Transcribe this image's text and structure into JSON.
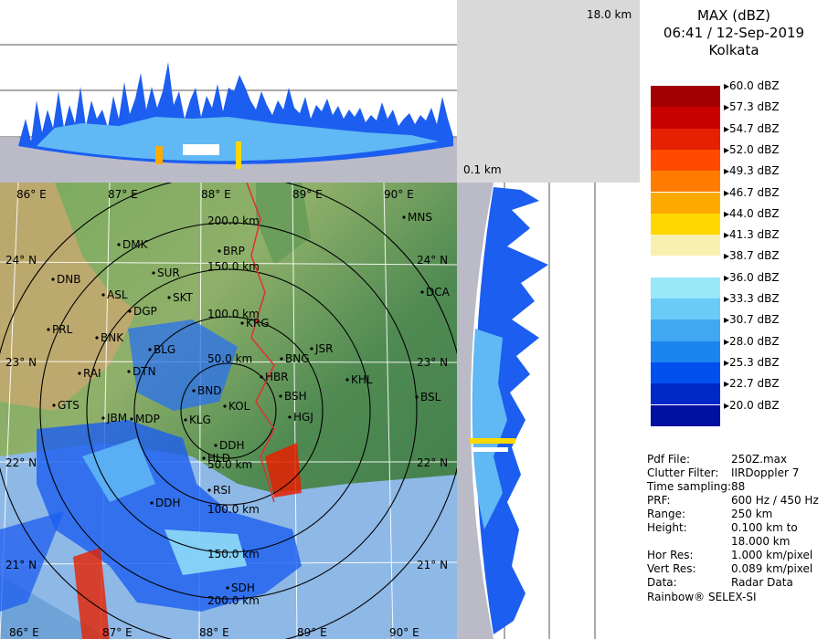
{
  "header": {
    "product": "MAX (dBZ)",
    "datetime": "06:41 / 12-Sep-2019",
    "station": "Kolkata"
  },
  "top_height_label": "18.0 km",
  "side_height_label": "0.1 km",
  "scale": [
    {
      "label": "60.0 dBZ",
      "color": "#a00000"
    },
    {
      "label": "57.3 dBZ",
      "color": "#c80000"
    },
    {
      "label": "54.7 dBZ",
      "color": "#e62000"
    },
    {
      "label": "52.0 dBZ",
      "color": "#ff4a00"
    },
    {
      "label": "49.3 dBZ",
      "color": "#ff7c00"
    },
    {
      "label": "46.7 dBZ",
      "color": "#ffaa00"
    },
    {
      "label": "44.0 dBZ",
      "color": "#ffd800"
    },
    {
      "label": "41.3 dBZ",
      "color": "#f8f0b0"
    },
    {
      "label": "38.7 dBZ",
      "color": "#ffffff"
    },
    {
      "label": "36.0 dBZ",
      "color": "#98e8f8"
    },
    {
      "label": "33.3 dBZ",
      "color": "#68ccf6"
    },
    {
      "label": "30.7 dBZ",
      "color": "#40a8f2"
    },
    {
      "label": "28.0 dBZ",
      "color": "#1c84ee"
    },
    {
      "label": "25.3 dBZ",
      "color": "#0050ee"
    },
    {
      "label": "22.7 dBZ",
      "color": "#0028c8"
    },
    {
      "label": "20.0 dBZ",
      "color": "#0010a0"
    }
  ],
  "info": [
    {
      "key": "Pdf File:",
      "value": "250Z.max"
    },
    {
      "key": "Clutter Filter:",
      "value": "IIRDoppler 7"
    },
    {
      "key": "Time sampling:",
      "value": "88"
    },
    {
      "key": "PRF:",
      "value": "600 Hz / 450 Hz"
    },
    {
      "key": "Range:",
      "value": "250 km"
    },
    {
      "key": "Height:",
      "value": "0.100 km to"
    },
    {
      "key": "",
      "value": "18.000 km"
    },
    {
      "key": "Hor Res:",
      "value": "1.000 km/pixel"
    },
    {
      "key": "Vert Res:",
      "value": "0.089 km/pixel"
    },
    {
      "key": "Data:",
      "value": "Radar Data"
    }
  ],
  "footer": "Rainbow® SELEX-SI",
  "map": {
    "lon_labels_top": [
      "86° E",
      "87° E",
      "88° E",
      "89° E",
      "90° E"
    ],
    "lon_labels_bottom": [
      "86° E",
      "87° E",
      "88° E",
      "89° E",
      "90° E"
    ],
    "lat_labels_left": [
      "24° N",
      "23° N",
      "22° N",
      "21° N"
    ],
    "lat_labels_right": [
      "24° N",
      "23° N",
      "22° N",
      "21° N"
    ],
    "range_rings": [
      "50.0 km",
      "100.0 km",
      "150.0 km",
      "200.0 km"
    ],
    "range_rings_top": [
      "50.0 km",
      "100.0 km",
      "150.0 km",
      "200.0 km"
    ],
    "stations": [
      "MNS",
      "DMK",
      "BRP",
      "SUR",
      "DNB",
      "ASL",
      "SKT",
      "DCA",
      "DGP",
      "KRG",
      "PRL",
      "BNK",
      "BLG",
      "JSR",
      "BNG",
      "RAI",
      "DTN",
      "HBR",
      "KHL",
      "BND",
      "KOL",
      "BSH",
      "BSL",
      "GTS",
      "HGJ",
      "JBM",
      "MDP",
      "KLG",
      "DDH",
      "HLD",
      "DDH",
      "RSI",
      "SDH"
    ]
  }
}
